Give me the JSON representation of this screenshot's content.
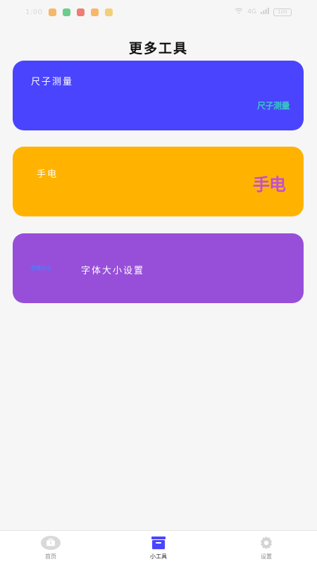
{
  "status_bar": {
    "time": "1:00",
    "right_text": "4G",
    "battery": "100",
    "icon_colors": [
      "#f7a23c",
      "#3bbf6a",
      "#e8564b",
      "#f7a23c",
      "#f2c14e"
    ]
  },
  "header": {
    "title": "更多工具"
  },
  "cards": {
    "ruler": {
      "label": "尺子测量",
      "decor": "尺子测量",
      "bg": "#4a44ff"
    },
    "flashlight": {
      "label": "手电",
      "decor": "手电",
      "bg": "#ffb300"
    },
    "font_size": {
      "label": "字体大小设置",
      "decor": "字体大小",
      "bg": "#974fd9"
    }
  },
  "tabbar": {
    "tabs": [
      {
        "label": "首页",
        "icon": "home-icon"
      },
      {
        "label": "小工具",
        "icon": "toolbox-icon",
        "active": true
      },
      {
        "label": "设置",
        "icon": "gear-icon"
      }
    ],
    "active_color": "#4a44ff"
  }
}
